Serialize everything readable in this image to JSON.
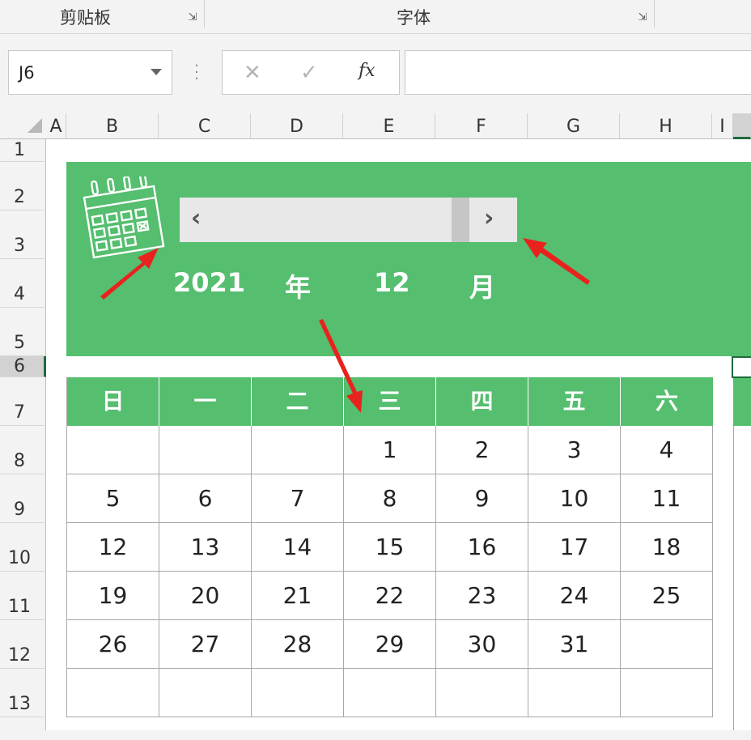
{
  "ribbon": {
    "groups": [
      {
        "label": "剪贴板"
      },
      {
        "label": "字体"
      }
    ],
    "launcher_glyph": "⇲"
  },
  "formula_bar": {
    "name_box": "J6",
    "cancel_glyph": "✕",
    "enter_glyph": "✓",
    "fx_label": "fx",
    "formula": ""
  },
  "columns": [
    "A",
    "B",
    "C",
    "D",
    "E",
    "F",
    "G",
    "H",
    "I"
  ],
  "rows": [
    "1",
    "2",
    "3",
    "4",
    "5",
    "6",
    "7",
    "8",
    "9",
    "10",
    "11",
    "12",
    "13"
  ],
  "banner": {
    "year": "2021",
    "year_unit": "年",
    "month": "12",
    "month_unit": "月",
    "prev_glyph": "‹",
    "next_glyph": "›"
  },
  "calendar": {
    "weekdays": [
      "日",
      "一",
      "二",
      "三",
      "四",
      "五",
      "六"
    ],
    "weeks": [
      [
        "",
        "",
        "",
        "1",
        "2",
        "3",
        "4"
      ],
      [
        "5",
        "6",
        "7",
        "8",
        "9",
        "10",
        "11"
      ],
      [
        "12",
        "13",
        "14",
        "15",
        "16",
        "17",
        "18"
      ],
      [
        "19",
        "20",
        "21",
        "22",
        "23",
        "24",
        "25"
      ],
      [
        "26",
        "27",
        "28",
        "29",
        "30",
        "31",
        ""
      ],
      [
        "",
        "",
        "",
        "",
        "",
        "",
        ""
      ]
    ]
  },
  "colors": {
    "accent_green": "#55be6f",
    "annotation_red": "#e8231e"
  },
  "icons": {
    "calendar": "calendar-icon",
    "scroll_prev": "chevron-left-icon",
    "scroll_next": "chevron-right-icon",
    "namebox_dropdown": "chevron-down-icon"
  }
}
